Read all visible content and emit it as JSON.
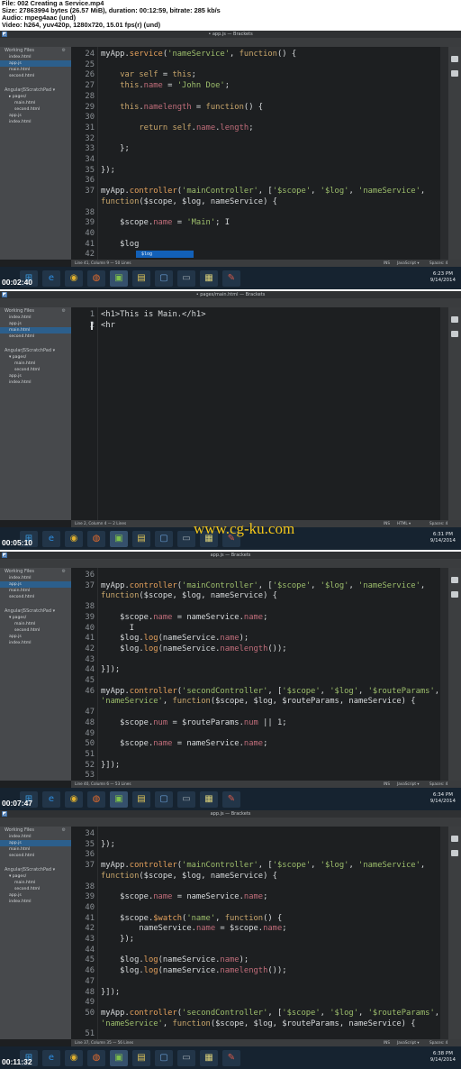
{
  "info": {
    "lines": [
      "File: 002 Creating a Service.mp4",
      "Size: 27863994 bytes (26.57 MiB), duration: 00:12:59, bitrate: 285 kb/s",
      "Audio: mpeg4aac (und)",
      "Video: h264, yuv420p, 1280x720, 15.01 fps(r) (und)"
    ]
  },
  "watermark": "www.cg-ku.com",
  "frames": [
    {
      "window_title": "• app.js — Brackets",
      "menu": [
        "File",
        "Edit",
        "Find",
        "View",
        "Navigate",
        "Debug",
        "Help"
      ],
      "sidebar": {
        "working_files_label": "Working Files",
        "working_files": [
          "index.html",
          "app.js",
          "main.html",
          "second.html"
        ],
        "selected": 1,
        "project_label": "AngularJSScratchPad ▾",
        "project_items": [
          {
            "label": "▸ pages/",
            "level": 1
          },
          {
            "label": "main.html",
            "level": 2
          },
          {
            "label": "second.html",
            "level": 2
          },
          {
            "label": "app.js",
            "level": 1
          },
          {
            "label": "index.html",
            "level": 1
          }
        ]
      },
      "code": [
        {
          "n": "24",
          "t": "myApp.service('nameService', function() {"
        },
        {
          "n": "25",
          "t": ""
        },
        {
          "n": "26",
          "t": "    var self = this;"
        },
        {
          "n": "27",
          "t": "    this.name = 'John Doe';"
        },
        {
          "n": "28",
          "t": ""
        },
        {
          "n": "29",
          "t": "    this.namelength = function() {"
        },
        {
          "n": "30",
          "t": ""
        },
        {
          "n": "31",
          "t": "        return self.name.length;"
        },
        {
          "n": "32",
          "t": ""
        },
        {
          "n": "33",
          "t": "    };"
        },
        {
          "n": "34",
          "t": ""
        },
        {
          "n": "35",
          "t": "});"
        },
        {
          "n": "36",
          "t": ""
        },
        {
          "n": "37",
          "t": "myApp.controller('mainController', ['$scope', '$log', 'nameService',"
        },
        {
          "n": "",
          "t": "function($scope, $log, nameService) {"
        },
        {
          "n": "38",
          "t": ""
        },
        {
          "n": "39",
          "t": "    $scope.name = 'Main'; I"
        },
        {
          "n": "40",
          "t": ""
        },
        {
          "n": "41",
          "t": "    $log"
        },
        {
          "n": "42",
          "t": ""
        }
      ],
      "hint": "$log",
      "status": {
        "left": "Line 41, Column 9 — 50 Lines",
        "ins": "INS",
        "lang": "JavaScript ▾",
        "spaces": "Spaces: 4"
      },
      "clock": {
        "time": "6:23 PM",
        "date": "9/14/2014"
      },
      "timestamp": "00:02:40"
    },
    {
      "window_title": "• pages/main.html — Brackets",
      "menu": [
        "File",
        "Edit",
        "Find",
        "View",
        "Navigate",
        "Debug",
        "Help"
      ],
      "sidebar": {
        "working_files_label": "Working Files",
        "working_files": [
          "index.html",
          "app.js",
          "main.html",
          "second.html"
        ],
        "selected": 2,
        "project_label": "AngularJSScratchPad ▾",
        "project_items": [
          {
            "label": "▾ pages/",
            "level": 1
          },
          {
            "label": "main.html",
            "level": 2
          },
          {
            "label": "second.html",
            "level": 2
          },
          {
            "label": "app.js",
            "level": 1
          },
          {
            "label": "index.html",
            "level": 1
          }
        ]
      },
      "code": [
        {
          "n": "1",
          "t": "<h1>This is Main.</h1>"
        },
        {
          "n": "2",
          "t": "<hr"
        }
      ],
      "status": {
        "left": "Line 2, Column 4 — 2 Lines",
        "ins": "INS",
        "lang": "HTML ▾",
        "spaces": "Spaces: 4"
      },
      "clock": {
        "time": "6:31 PM",
        "date": "9/14/2014"
      },
      "timestamp": "00:05:10"
    },
    {
      "window_title": "app.js — Brackets",
      "menu": [
        "File",
        "Edit",
        "Find",
        "View",
        "Navigate",
        "Debug",
        "Help"
      ],
      "sidebar": {
        "working_files_label": "Working Files",
        "working_files": [
          "index.html",
          "app.js",
          "main.html",
          "second.html"
        ],
        "selected": 1,
        "project_label": "AngularJSScratchPad ▾",
        "project_items": [
          {
            "label": "▾ pages/",
            "level": 1
          },
          {
            "label": "main.html",
            "level": 2
          },
          {
            "label": "second.html",
            "level": 2
          },
          {
            "label": "app.js",
            "level": 1
          },
          {
            "label": "index.html",
            "level": 1
          }
        ]
      },
      "code": [
        {
          "n": "36",
          "t": ""
        },
        {
          "n": "37",
          "t": "myApp.controller('mainController', ['$scope', '$log', 'nameService',"
        },
        {
          "n": "",
          "t": "function($scope, $log, nameService) {"
        },
        {
          "n": "38",
          "t": ""
        },
        {
          "n": "39",
          "t": "    $scope.name = nameService.name;"
        },
        {
          "n": "40",
          "t": "      I"
        },
        {
          "n": "41",
          "t": "    $log.log(nameService.name);"
        },
        {
          "n": "42",
          "t": "    $log.log(nameService.namelength());"
        },
        {
          "n": "43",
          "t": ""
        },
        {
          "n": "44",
          "t": "}]);"
        },
        {
          "n": "45",
          "t": ""
        },
        {
          "n": "46",
          "t": "myApp.controller('secondController', ['$scope', '$log', '$routeParams',"
        },
        {
          "n": "",
          "t": "'nameService', function($scope, $log, $routeParams, nameService) {"
        },
        {
          "n": "47",
          "t": ""
        },
        {
          "n": "48",
          "t": "    $scope.num = $routeParams.num || 1;"
        },
        {
          "n": "49",
          "t": ""
        },
        {
          "n": "50",
          "t": "    $scope.name = nameService.name;"
        },
        {
          "n": "51",
          "t": ""
        },
        {
          "n": "52",
          "t": "}]);"
        },
        {
          "n": "53",
          "t": ""
        }
      ],
      "status": {
        "left": "Line 40, Column 6 — 53 Lines",
        "ins": "INS",
        "lang": "JavaScript ▾",
        "spaces": "Spaces: 4"
      },
      "clock": {
        "time": "6:34 PM",
        "date": "9/14/2014"
      },
      "timestamp": "00:07:47"
    },
    {
      "window_title": "app.js — Brackets",
      "menu": [
        "File",
        "Edit",
        "Find",
        "View",
        "Navigate",
        "Debug",
        "Help"
      ],
      "sidebar": {
        "working_files_label": "Working Files",
        "working_files": [
          "index.html",
          "app.js",
          "main.html",
          "second.html"
        ],
        "selected": 1,
        "project_label": "AngularJSScratchPad ▾",
        "project_items": [
          {
            "label": "▾ pages/",
            "level": 1
          },
          {
            "label": "main.html",
            "level": 2
          },
          {
            "label": "second.html",
            "level": 2
          },
          {
            "label": "app.js",
            "level": 1
          },
          {
            "label": "index.html",
            "level": 1
          }
        ]
      },
      "code": [
        {
          "n": "34",
          "t": ""
        },
        {
          "n": "35",
          "t": "});"
        },
        {
          "n": "36",
          "t": ""
        },
        {
          "n": "37",
          "t": "myApp.controller('mainController', ['$scope', '$log', 'nameService',"
        },
        {
          "n": "",
          "t": "function($scope, $log, nameService) {"
        },
        {
          "n": "38",
          "t": ""
        },
        {
          "n": "39",
          "t": "    $scope.name = nameService.name;"
        },
        {
          "n": "40",
          "t": ""
        },
        {
          "n": "41",
          "t": "    $scope.$watch('name', function() {"
        },
        {
          "n": "42",
          "t": "        nameService.name = $scope.name;"
        },
        {
          "n": "43",
          "t": "    });"
        },
        {
          "n": "44",
          "t": ""
        },
        {
          "n": "45",
          "t": "    $log.log(nameService.name);"
        },
        {
          "n": "46",
          "t": "    $log.log(nameService.namelength());"
        },
        {
          "n": "47",
          "t": ""
        },
        {
          "n": "48",
          "t": "}]);"
        },
        {
          "n": "49",
          "t": ""
        },
        {
          "n": "50",
          "t": "myApp.controller('secondController', ['$scope', '$log', '$routeParams',"
        },
        {
          "n": "",
          "t": "'nameService', function($scope, $log, $routeParams, nameService) {"
        },
        {
          "n": "51",
          "t": ""
        }
      ],
      "status": {
        "left": "Line 37, Column 35 — 56 Lines",
        "ins": "INS",
        "lang": "JavaScript ▾",
        "spaces": "Spaces: 4"
      },
      "clock": {
        "time": "6:38 PM",
        "date": "9/14/2014"
      },
      "timestamp": "00:11:32"
    }
  ],
  "taskbar_icons": [
    "windows-start-icon",
    "ie-icon",
    "chrome-icon",
    "firefox-icon",
    "brackets-icon",
    "explorer-icon",
    "presenter-icon",
    "window-icon",
    "notes-icon",
    "tool-icon"
  ]
}
